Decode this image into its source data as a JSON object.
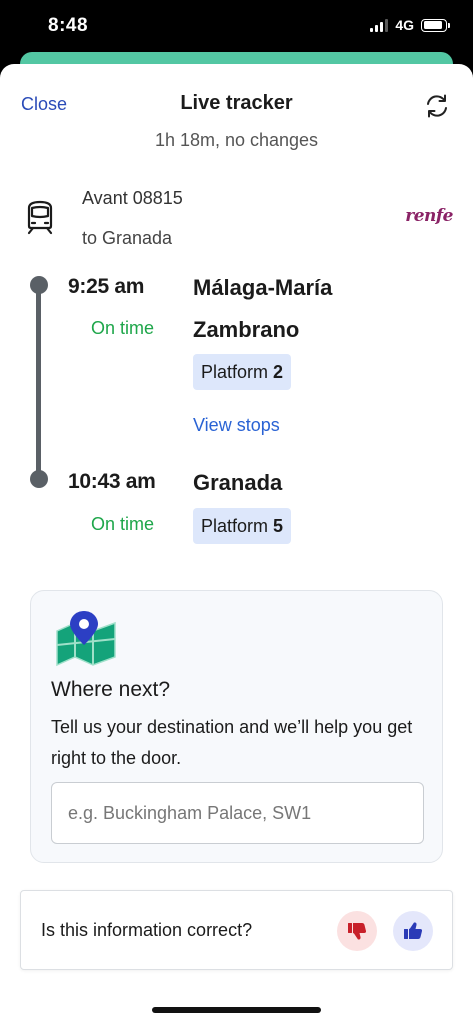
{
  "status_bar": {
    "time": "8:48",
    "network": "4G",
    "signal_bars": 3,
    "battery_level": 0.9
  },
  "colors": {
    "accent_blue": "#2a4bb8",
    "link_blue": "#2a63d4",
    "on_time_green": "#1ea64a",
    "platform_bg": "#dde7fb",
    "timeline_grey": "#5a6066",
    "operator_brand": "#8a2366",
    "sheet_handle_teal": "#53c7a3"
  },
  "header": {
    "close_label": "Close",
    "title": "Live tracker",
    "subtitle": "1h 18m, no changes",
    "refresh_icon": "refresh-icon"
  },
  "service": {
    "icon": "train-icon",
    "name": "Avant 08815",
    "destination": "to Granada",
    "operator": "renfe"
  },
  "journey": {
    "departure": {
      "time": "9:25 am",
      "status": "On time",
      "station_line1": "Málaga-María",
      "station_line2": "Zambrano",
      "platform_label": "Platform",
      "platform_number": "2"
    },
    "view_stops_label": "View stops",
    "arrival": {
      "time": "10:43 am",
      "status": "On time",
      "station": "Granada",
      "platform_label": "Platform",
      "platform_number": "5"
    }
  },
  "where_next": {
    "icon": "map-pin-icon",
    "title": "Where next?",
    "description": "Tell us your destination and we’ll help you get right to the door.",
    "input_value": "",
    "input_placeholder": "e.g. Buckingham Palace, SW1"
  },
  "feedback": {
    "question": "Is this information correct?",
    "thumbs_down_icon": "thumbs-down-icon",
    "thumbs_up_icon": "thumbs-up-icon"
  }
}
